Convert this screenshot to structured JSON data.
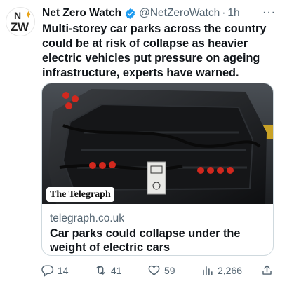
{
  "author": {
    "avatar_letters_top": "N",
    "avatar_letters_bottom": "ZW",
    "name": "Net Zero Watch",
    "handle": "@NetZeroWatch",
    "separator": "·",
    "time": "1h",
    "more_label": "···"
  },
  "tweet": {
    "text": "Multi-storey car parks across the country could be at risk of collapse as heavier electric vehicles put pressure on ageing infrastructure, experts have warned."
  },
  "card": {
    "source_badge": "The Telegraph",
    "domain": "telegraph.co.uk",
    "title": "Car parks could collapse under the weight of electric cars"
  },
  "actions": {
    "replies": "14",
    "retweets": "41",
    "likes": "59",
    "views": "2,266"
  },
  "colors": {
    "text_primary": "#0f1419",
    "text_secondary": "#536471",
    "verified_blue": "#1d9bf0",
    "border": "#cfd9de"
  },
  "icons": {
    "verified": "verified-badge-icon",
    "reply": "reply-icon",
    "retweet": "retweet-icon",
    "like": "heart-icon",
    "views": "views-chart-icon",
    "share": "share-icon",
    "more": "more-dots-icon"
  }
}
